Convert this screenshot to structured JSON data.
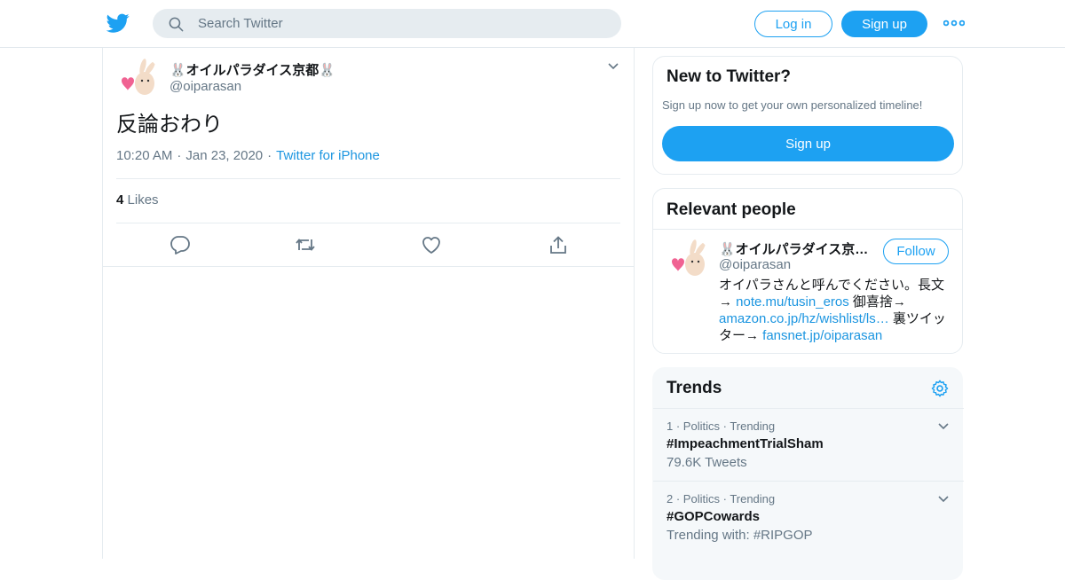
{
  "header": {
    "search_placeholder": "Search Twitter",
    "login_label": "Log in",
    "signup_label": "Sign up",
    "brand_color": "#1da1f2"
  },
  "tweet": {
    "display_name": "🐰オイルパラダイス京都🐰",
    "handle": "@oiparasan",
    "text": "反論おわり",
    "time": "10:20 AM",
    "date": "Jan 23, 2020",
    "source": "Twitter for iPhone",
    "likes_count": "4",
    "likes_label": "Likes",
    "actions": [
      "reply-icon",
      "retweet-icon",
      "like-icon",
      "share-icon"
    ]
  },
  "new_to_twitter": {
    "title": "New to Twitter?",
    "subtitle": "Sign up now to get your own personalized timeline!",
    "button": "Sign up"
  },
  "relevant_people": {
    "title": "Relevant people",
    "name": "🐰オイルパラダイス京都🐰",
    "handle": "@oiparasan",
    "follow_label": "Follow",
    "bio_1": "オイパラさんと呼んでください。長文→ ",
    "bio_link_1": "note.mu/tusin_eros",
    "bio_2": " 御喜捨→ ",
    "bio_link_2": "amazon.co.jp/hz/wishlist/ls…",
    "bio_3": " 裏ツイッター→ ",
    "bio_link_3": "fansnet.jp/oiparasan"
  },
  "trends": {
    "title": "Trends",
    "items": [
      {
        "rank": "1",
        "category": "Politics",
        "status": "Trending",
        "name": "#ImpeachmentTrialSham",
        "count": "79.6K Tweets"
      },
      {
        "rank": "2",
        "category": "Politics",
        "status": "Trending",
        "name": "#GOPCowards",
        "count": "Trending with: #RIPGOP"
      }
    ]
  }
}
